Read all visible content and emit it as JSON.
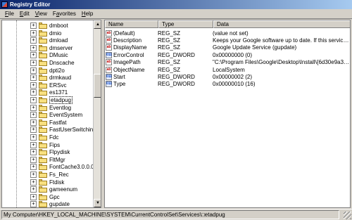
{
  "window": {
    "title": "Registry Editor"
  },
  "menu": [
    {
      "prefix": "",
      "underline": "F",
      "rest": "ile"
    },
    {
      "prefix": "",
      "underline": "E",
      "rest": "dit"
    },
    {
      "prefix": "",
      "underline": "V",
      "rest": "iew"
    },
    {
      "prefix": "F",
      "underline": "a",
      "rest": "vorites"
    },
    {
      "prefix": "",
      "underline": "H",
      "rest": "elp"
    }
  ],
  "tree": {
    "expander_symbol": "+",
    "items": [
      {
        "label": "dmboot"
      },
      {
        "label": "dmio"
      },
      {
        "label": "dmload"
      },
      {
        "label": "dmserver"
      },
      {
        "label": "DMusic"
      },
      {
        "label": "Dnscache"
      },
      {
        "label": "dpti2o"
      },
      {
        "label": "drmkaud"
      },
      {
        "label": "ERSvc"
      },
      {
        "label": "es1371"
      },
      {
        "label": "etadpug",
        "selected": true
      },
      {
        "label": "Eventlog"
      },
      {
        "label": "EventSystem"
      },
      {
        "label": "Fastfat"
      },
      {
        "label": "FastUserSwitchingCor"
      },
      {
        "label": "Fdc"
      },
      {
        "label": "Fips"
      },
      {
        "label": "Flpydisk"
      },
      {
        "label": "FltMgr"
      },
      {
        "label": "FontCache3.0.0.0"
      },
      {
        "label": "Fs_Rec"
      },
      {
        "label": "Ftdisk"
      },
      {
        "label": "gameenum"
      },
      {
        "label": "Gpc"
      },
      {
        "label": "gupdate"
      }
    ]
  },
  "list": {
    "columns": [
      "Name",
      "Type",
      "Data"
    ],
    "rows": [
      {
        "icon": "string-value-icon",
        "kind": "sz",
        "glyph": "ab",
        "name": "(Default)",
        "type": "REG_SZ",
        "data": "(value not set)"
      },
      {
        "icon": "string-value-icon",
        "kind": "sz",
        "glyph": "ab",
        "name": "Description",
        "type": "REG_SZ",
        "data": "Keeps your Google software up to date. If this service ..."
      },
      {
        "icon": "string-value-icon",
        "kind": "sz",
        "glyph": "ab",
        "name": "DisplayName",
        "type": "REG_SZ",
        "data": "Google Update Service (gupdate)"
      },
      {
        "icon": "binary-value-icon",
        "kind": "dword",
        "glyph": "011",
        "name": "ErrorControl",
        "type": "REG_DWORD",
        "data": "0x00000000 (0)"
      },
      {
        "icon": "string-value-icon",
        "kind": "sz",
        "glyph": "ab",
        "name": "ImagePath",
        "type": "REG_SZ",
        "data": "\"C:\\Program Files\\Google\\Desktop\\Install\\{6d30e9a3-c..."
      },
      {
        "icon": "string-value-icon",
        "kind": "sz",
        "glyph": "ab",
        "name": "ObjectName",
        "type": "REG_SZ",
        "data": "LocalSystem"
      },
      {
        "icon": "binary-value-icon",
        "kind": "dword",
        "glyph": "011",
        "name": "Start",
        "type": "REG_DWORD",
        "data": "0x00000002 (2)"
      },
      {
        "icon": "binary-value-icon",
        "kind": "dword",
        "glyph": "011",
        "name": "Type",
        "type": "REG_DWORD",
        "data": "0x00000010 (16)"
      }
    ]
  },
  "status": {
    "path": "My Computer\\HKEY_LOCAL_MACHINE\\SYSTEM\\CurrentControlSet\\Services\\□etadpug"
  }
}
